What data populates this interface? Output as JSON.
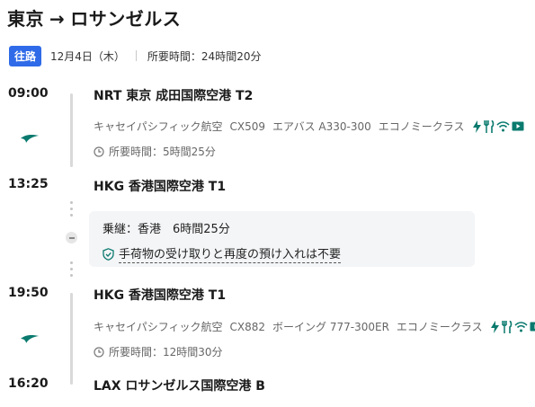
{
  "header": {
    "origin": "東京",
    "arrow": "→",
    "destination": "ロサンゼルス"
  },
  "trip": {
    "badge": "往路",
    "date": "12月4日（木）",
    "total_duration": "所要時間：24時間20分"
  },
  "segments": [
    {
      "dep_time": "09:00",
      "dep_airport": "NRT 東京 成田国際空港 T2",
      "airline": "キャセイパシフィック航空",
      "flight_no": "CX509",
      "aircraft": "エアバス A330-300",
      "cabin": "エコノミークラス",
      "duration": "所要時間：5時間25分",
      "arr_time": "13:25",
      "arr_airport": "HKG 香港国際空港 T1"
    },
    {
      "dep_time": "19:50",
      "dep_airport": "HKG 香港国際空港 T1",
      "airline": "キャセイパシフィック航空",
      "flight_no": "CX882",
      "aircraft": "ボーイング 777-300ER",
      "cabin": "エコノミークラス",
      "duration": "所要時間：12時間30分",
      "arr_time": "16:20",
      "arr_airport": "LAX ロサンゼルス国際空港 B"
    }
  ],
  "layover": {
    "title": "乗継：香港　6時間25分",
    "note": "手荷物の受け取りと再度の預け入れは不要"
  },
  "icons": {
    "airline": "cathay-pacific-logo-icon",
    "amenities": [
      "power-icon",
      "meal-icon",
      "wifi-icon",
      "entertainment-icon"
    ],
    "duration": "clock-icon",
    "baggage": "shield-check-icon"
  },
  "colors": {
    "badge": "#2f6be8",
    "airline": "#0a7a6e",
    "amenity": "#0a7a6e"
  }
}
